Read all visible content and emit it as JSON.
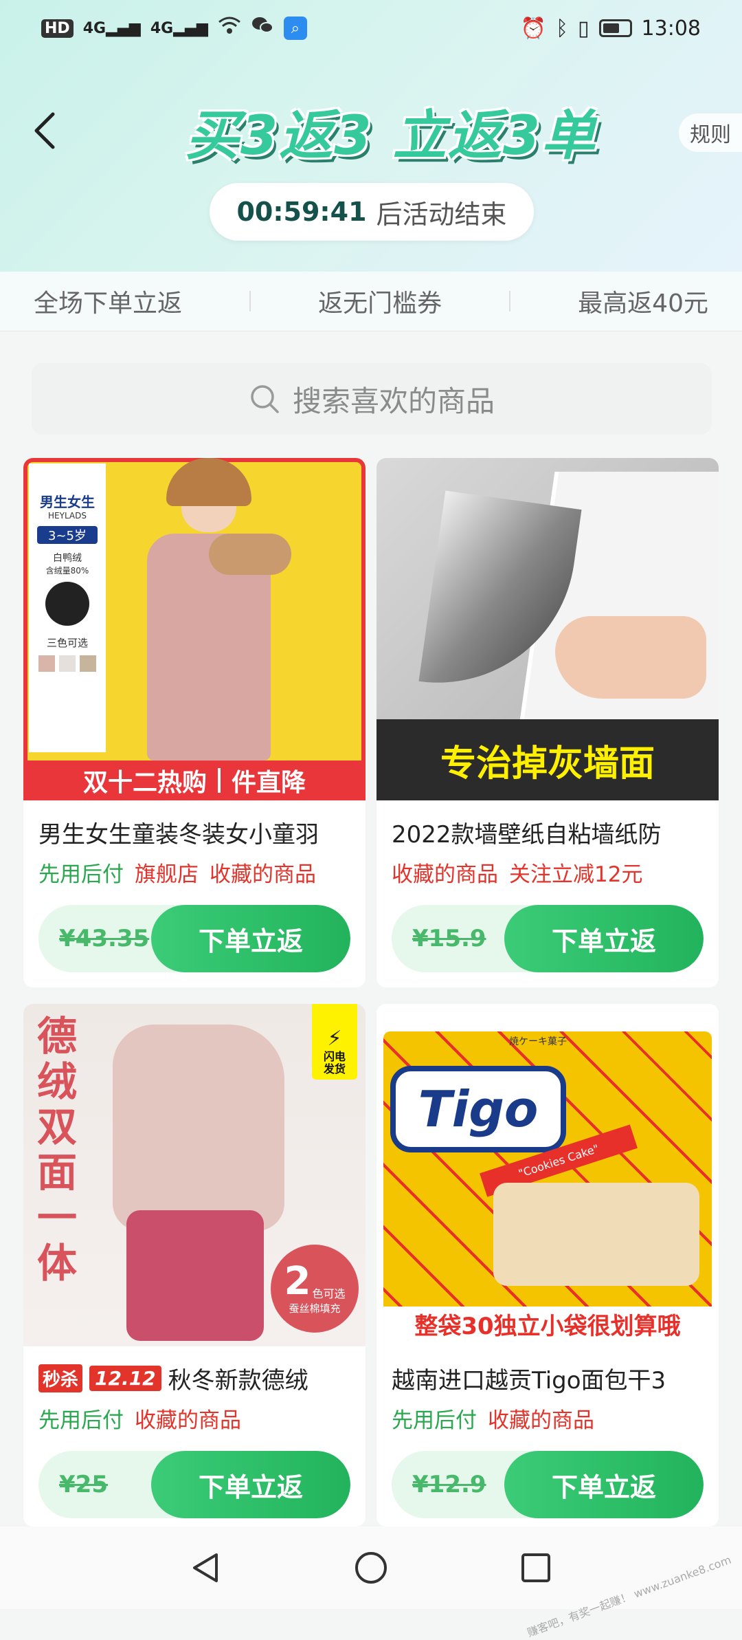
{
  "status_bar": {
    "left_chip": "HD",
    "net1": "4G",
    "net2": "4G",
    "time": "13:08"
  },
  "header": {
    "banner_title": "买3返3 立返3单",
    "rules_label": "规则",
    "countdown_time": "00:59:41",
    "countdown_suffix": "后活动结束"
  },
  "feature_bar": {
    "items": [
      "全场下单立返",
      "返无门槛券",
      "最高返40元"
    ]
  },
  "search": {
    "placeholder": "搜索喜欢的商品"
  },
  "products": [
    {
      "title": "男生女生童装冬装女小童羽",
      "tags": [
        {
          "text": "先用后付",
          "color": "green"
        },
        {
          "text": "旗舰店",
          "color": "red"
        },
        {
          "text": "收藏的商品",
          "color": "red"
        }
      ],
      "price": "¥43.35",
      "button": "下单立返",
      "image": {
        "brand": "男生女生",
        "brand_en": "HEYLADS",
        "age": "3~5岁",
        "down_note": "白鸭绒",
        "down_note2": "含绒量80%",
        "colors_note": "三色可选",
        "caption_left": "双十二热购",
        "caption_right": "件直降"
      }
    },
    {
      "title": "2022款墙壁纸自粘墙纸防",
      "tags": [
        {
          "text": "收藏的商品",
          "color": "red"
        },
        {
          "text": "关注立减12元",
          "color": "red"
        }
      ],
      "price": "¥15.9",
      "button": "下单立返",
      "image": {
        "caption": "专治掉灰墙面"
      }
    },
    {
      "title": "秋冬新款德绒",
      "title_badge_1": "秒杀",
      "title_badge_2": "12.12",
      "tags": [
        {
          "text": "先用后付",
          "color": "green"
        },
        {
          "text": "收藏的商品",
          "color": "red"
        }
      ],
      "price": "¥25",
      "button": "下单立返",
      "image": {
        "vertical_text": [
          "德",
          "绒",
          "双",
          "面",
          "一",
          "体"
        ],
        "flash_label": "闪电发货",
        "color_count": "2",
        "color_label": "色可选",
        "fill_label": "蚕丝棉填充"
      }
    },
    {
      "title": "越南进口越贡Tigo面包干3",
      "tags": [
        {
          "text": "先用后付",
          "color": "green"
        },
        {
          "text": "收藏的商品",
          "color": "red"
        }
      ],
      "price": "¥12.9",
      "button": "下单立返",
      "image": {
        "brand": "Tigo",
        "label_top": "焼ケーキ菓子",
        "ribbon": "\"Cookies Cake\"",
        "caption": "整袋30独立小袋很划算哦"
      }
    }
  ],
  "watermark": "赚客吧，有奖一起赚！ www.zuanke8.com",
  "colors": {
    "accent_green": "#2aa84f",
    "accent_red": "#e2342b",
    "header_bg": "#c9f1ea"
  }
}
